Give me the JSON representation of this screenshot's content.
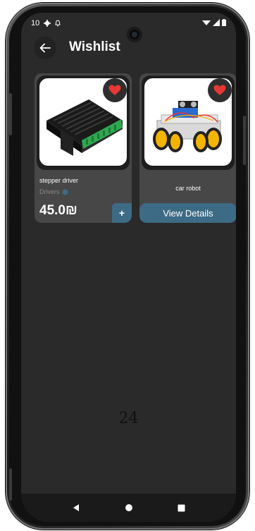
{
  "status": {
    "time": "10"
  },
  "header": {
    "title": "Wishlist"
  },
  "products": [
    {
      "name": "stepper driver",
      "category": "Drivers",
      "price": "45.0₪",
      "add_label": "+"
    },
    {
      "name": "car robot",
      "action_label": "View Details"
    }
  ],
  "page_number": "24",
  "colors": {
    "background": "#2a2a2a",
    "card": "#474747",
    "accent": "#3d6b85",
    "heart": "#e53935"
  },
  "icons": {
    "back": "arrow-left-icon",
    "favorite": "heart-icon",
    "nav": [
      "back-triangle-icon",
      "home-circle-icon",
      "recents-square-icon"
    ]
  }
}
